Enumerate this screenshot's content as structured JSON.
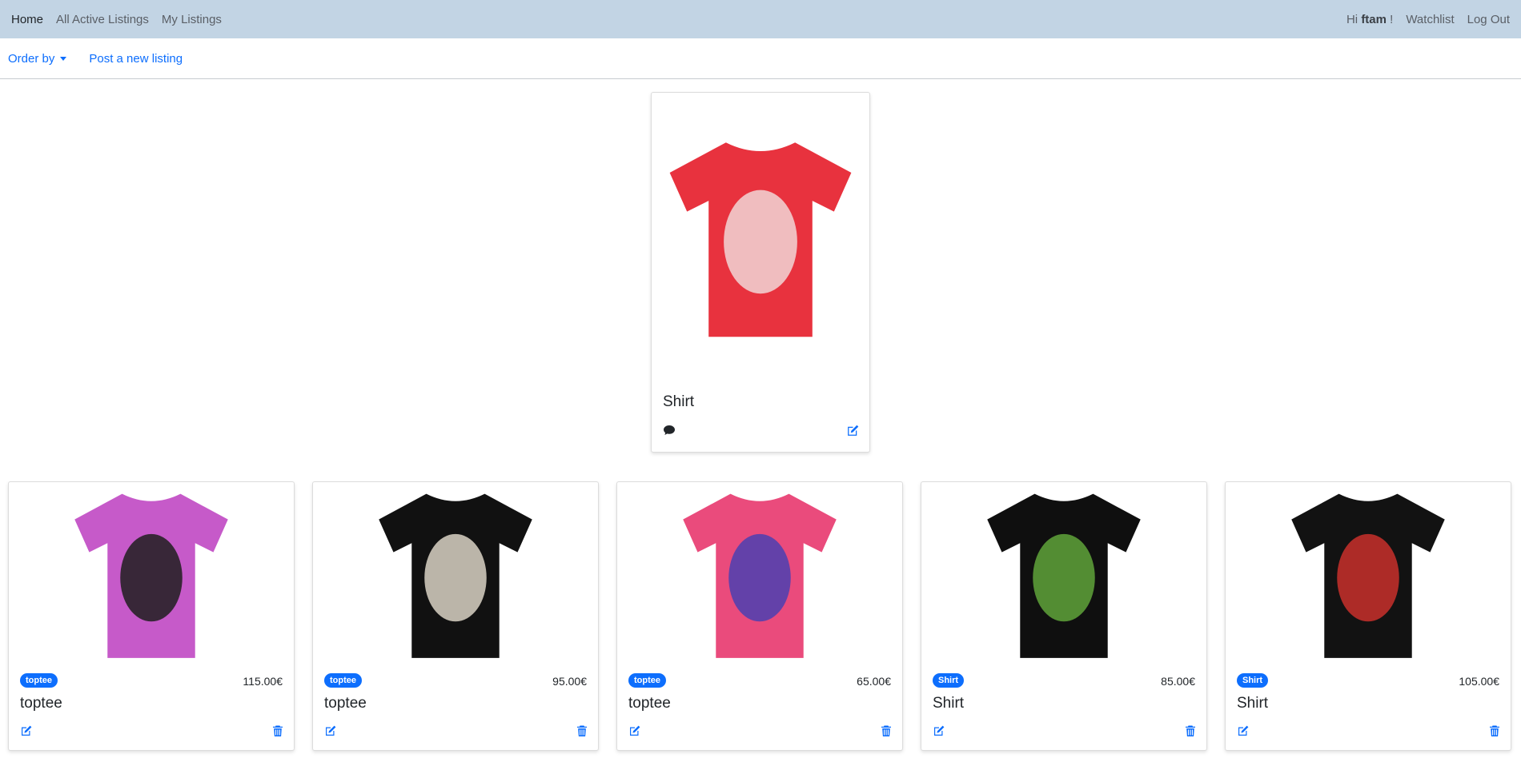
{
  "nav": {
    "home": "Home",
    "all_active": "All Active Listings",
    "my_listings": "My Listings",
    "greeting_prefix": "Hi",
    "username": "ftam",
    "greeting_suffix": "!",
    "watchlist": "Watchlist",
    "logout": "Log Out"
  },
  "subnav": {
    "order_by": "Order by",
    "post_new": "Post a new listing"
  },
  "featured": {
    "title": "Shirt",
    "image": "red-graphic-shirt",
    "icons": [
      "comment-icon",
      "edit-icon"
    ]
  },
  "listings": [
    {
      "category": "toptee",
      "price": "115.00€",
      "title": "toptee",
      "image": "pink-blink-182-tee"
    },
    {
      "category": "toptee",
      "price": "95.00€",
      "title": "toptee",
      "image": "black-floral-top"
    },
    {
      "category": "toptee",
      "price": "65.00€",
      "title": "toptee",
      "image": "pink-purple-haze-tee"
    },
    {
      "category": "Shirt",
      "price": "85.00€",
      "title": "Shirt",
      "image": "black-buds-tee"
    },
    {
      "category": "Shirt",
      "price": "105.00€",
      "title": "Shirt",
      "image": "black-superman-tee"
    }
  ],
  "colors": {
    "navbar_bg": "#c2d4e4",
    "link_blue": "#0d6efd",
    "badge_bg": "#0d6efd"
  },
  "shirt_images": {
    "red-graphic-shirt": {
      "fill": "#e8323e",
      "art": "#f1d6d6"
    },
    "pink-blink-182-tee": {
      "fill": "#c65ac9",
      "art": "#1e1e1e"
    },
    "black-floral-top": {
      "fill": "#111111",
      "art": "#d9d2c4"
    },
    "pink-purple-haze-tee": {
      "fill": "#ea4b7c",
      "art": "#4b3fb2"
    },
    "black-buds-tee": {
      "fill": "#0f0f0f",
      "art": "#5fa33a"
    },
    "black-superman-tee": {
      "fill": "#121212",
      "art": "#c9302c"
    }
  }
}
